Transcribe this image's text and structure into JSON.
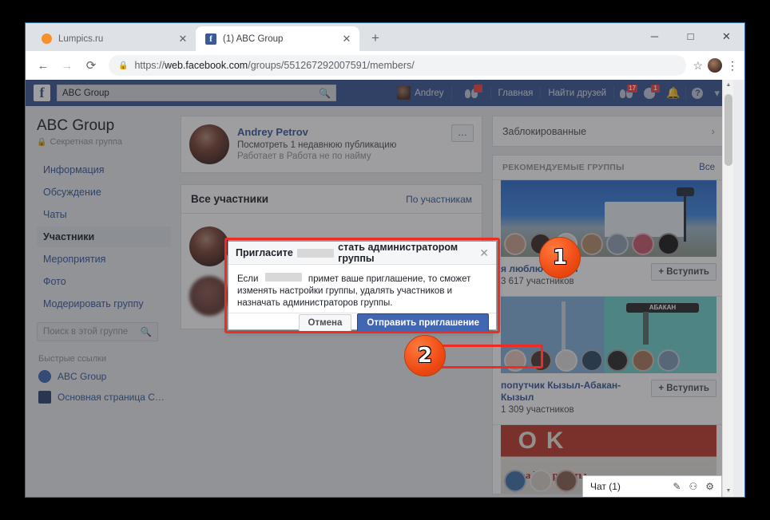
{
  "browser": {
    "tabs": [
      {
        "title": "Lumpics.ru",
        "favicon": "orange-dot-icon",
        "active": false,
        "close": "✕"
      },
      {
        "title": "(1) ABC Group",
        "favicon": "facebook-icon",
        "active": true,
        "close": "✕"
      }
    ],
    "newtab_label": "+",
    "window_controls": {
      "minimize": "─",
      "maximize": "□",
      "close": "✕"
    },
    "nav": {
      "back": "←",
      "forward": "→",
      "reload": "⟳"
    },
    "omnibox": {
      "lock_icon": "lock-icon",
      "url_scheme": "https://",
      "url_host": "web.facebook.com",
      "url_path": "/groups/551267292007591/members/"
    },
    "star_icon": "☆",
    "menu_icon": "⋮"
  },
  "fbbar": {
    "logo": "f",
    "search_value": "ABC Group",
    "search_icon": "🔍",
    "profile_name": "Andrey",
    "friend_requests_label": "",
    "home_label": "Главная",
    "find_friends_label": "Найти друзей",
    "badges": {
      "friends": "17",
      "messages": "1"
    },
    "bell_icon": "🔔",
    "help_icon": "?",
    "caret_icon": "▾"
  },
  "sidebar": {
    "group_name": "ABC Group",
    "group_privacy": "Секретная группа",
    "lock_icon": "🔒",
    "items": [
      {
        "label": "Информация",
        "active": false
      },
      {
        "label": "Обсуждение",
        "active": false
      },
      {
        "label": "Чаты",
        "active": false
      },
      {
        "label": "Участники",
        "active": true
      },
      {
        "label": "Мероприятия",
        "active": false
      },
      {
        "label": "Фото",
        "active": false
      },
      {
        "label": "Модерировать группу",
        "active": false
      }
    ],
    "search_placeholder": "Поиск в этой группе",
    "search_icon": "🔍",
    "quick_links_title": "Быстрые ссылки",
    "quick_links": [
      {
        "label": "ABC Group",
        "icon": "group-icon"
      },
      {
        "label": "Основная страница С…",
        "icon": "page-icon"
      }
    ]
  },
  "post": {
    "author": "Andrey Petrov",
    "line1": "Посмотреть 1 недавнюю публикацию",
    "line2": "Работает в Работа не по найму",
    "more_icon": "…"
  },
  "members": {
    "title": "Все участники",
    "filter": "По участникам"
  },
  "rightcol": {
    "blocked_label": "Заблокированные",
    "chevron": "›",
    "rec_title": "РЕКОМЕНДУЕМЫЕ ГРУППЫ",
    "rec_all": "Все",
    "groups": [
      {
        "name": "я люблю кызыл",
        "count": "3 617 участников",
        "join_label": "+ Вступить"
      },
      {
        "name": "попутчик Кызыл-Абакан-Кызыл",
        "count": "1 309 участников",
        "join_label": "+ Вступить",
        "cover_text": "АБАКАН"
      },
      {
        "name": "",
        "count": "",
        "join_label": "",
        "cover_text": "График работы"
      }
    ]
  },
  "chatdock": {
    "label": "Чат (1)",
    "compose_icon": "✎",
    "people_icon": "⚇",
    "gear_icon": "⚙"
  },
  "modal": {
    "title_before": "Пригласите",
    "title_after": "стать администратором группы",
    "close_icon": "✕",
    "body_before": "Если",
    "body_after": "примет ваше приглашение, то сможет изменять настройки группы, удалять участников и назначать администраторов группы.",
    "cancel_label": "Отмена",
    "send_label": "Отправить приглашение"
  },
  "annotations": {
    "marker1": "1",
    "marker2": "2",
    "accent_color": "#ee2b24",
    "marker_color": "#ef4b14"
  },
  "scrollbar": {
    "up": "▲",
    "down": "▼"
  }
}
